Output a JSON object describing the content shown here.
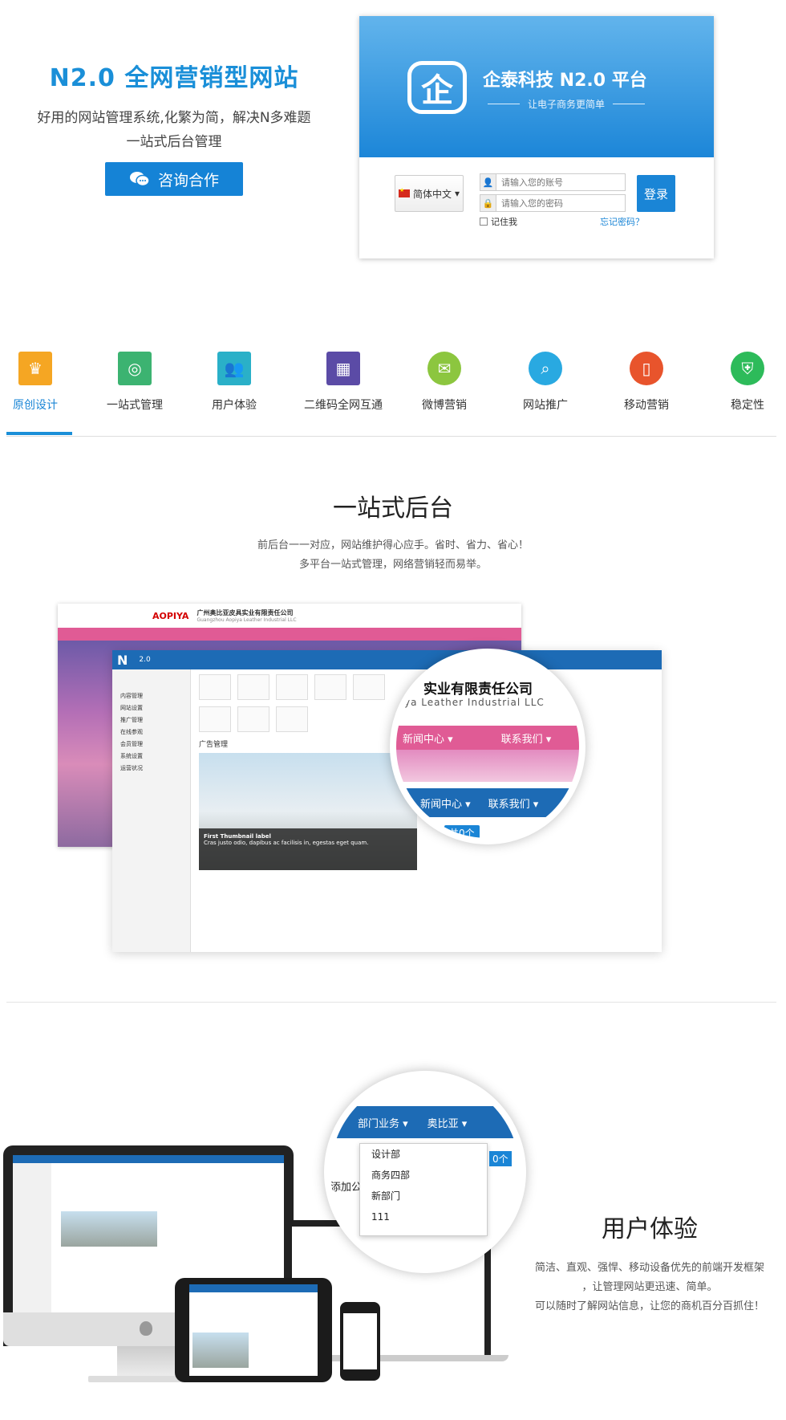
{
  "hero": {
    "title": "N2.0 全网营销型网站",
    "desc_line1": "好用的网站管理系统,化繁为简，解决N多难题",
    "desc_line2": "一站式后台管理",
    "consult_label": "咨询合作"
  },
  "login": {
    "brand": "企泰科技 N2.0 平台",
    "tagline": "让电子商务更简单",
    "language": "简体中文",
    "account_placeholder": "请输入您的账号",
    "password_placeholder": "请输入您的密码",
    "login_label": "登录",
    "remember_label": "记住我",
    "forgot_label": "忘记密码？"
  },
  "features": [
    {
      "label": "原创设计",
      "color": "#f5a623",
      "icon": "crown-icon"
    },
    {
      "label": "一站式管理",
      "color": "#3cb371",
      "icon": "target-icon"
    },
    {
      "label": "用户体验",
      "color": "#2ab0c8",
      "icon": "users-icon"
    },
    {
      "label": "二维码全网互通",
      "color": "#5b4ba6",
      "icon": "qrcode-icon"
    },
    {
      "label": "微博营销",
      "color": "#8cc63f",
      "icon": "chat-bubble-icon"
    },
    {
      "label": "网站推广",
      "color": "#29a9e1",
      "icon": "search-icon"
    },
    {
      "label": "移动营销",
      "color": "#e8542c",
      "icon": "mobile-icon"
    },
    {
      "label": "稳定性",
      "color": "#2dbb5a",
      "icon": "shield-icon"
    }
  ],
  "section2": {
    "title": "一站式后台",
    "desc_line1": "前后台一一对应，网站维护得心应手。省时、省力、省心！",
    "desc_line2": "多平台一站式管理，网络营销轻而易举。"
  },
  "mock_front": {
    "company_cn": "广州奥比亚皮具实业有限责任公司",
    "company_en": "Guangzhou Aopiya Leather Industrial LLC"
  },
  "mock_admin": {
    "logo": "N",
    "version": "2.0",
    "sidebar": [
      "内容管理",
      "网站设置",
      "推广管理",
      "在线参观",
      "会员管理",
      "系统设置",
      "运营状况"
    ],
    "section_label": "广告管理",
    "gallery_caption_title": "First Thumbnail label",
    "gallery_caption_text": "Cras justo odio, dapibus ac facilisis in, egestas eget quam."
  },
  "zoom1": {
    "company": "实业有限责任公司",
    "company_en": "ya Leather Industrial LLC",
    "nav_news": "新闻中心 ▾",
    "nav_contact": "联系我们 ▾",
    "admin_nav_news": "新闻中心 ▾",
    "admin_nav_contact": "联系我们 ▾",
    "badge": "共0个"
  },
  "section3": {
    "title": "用户体验",
    "desc_line1": "简洁、直观、强悍、移动设备优先的前端开发框架",
    "desc_line2": "，让管理网站更迅速、简单。",
    "desc_line3": "可以随时了解网站信息，让您的商机百分百抓住！"
  },
  "zoom2": {
    "nav_dept": "部门业务 ▾",
    "nav_aobiya": "奥比亚 ▾",
    "menu": [
      "设计部",
      "商务四部",
      "新部门",
      "111"
    ],
    "side_label": "添加公",
    "badge": "0个"
  }
}
